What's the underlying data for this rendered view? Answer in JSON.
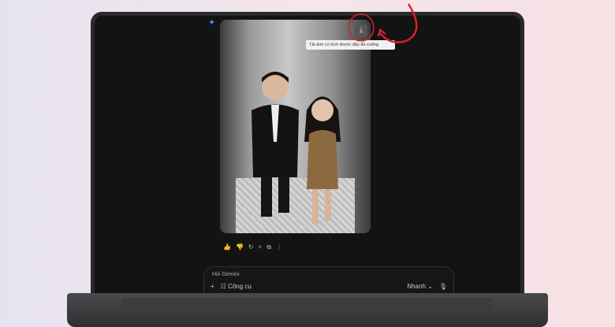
{
  "tooltip": {
    "text": "Tải ảnh có kích thước đầy đủ xuống"
  },
  "icons": {
    "download": "download-icon",
    "star": "gemini-star-icon"
  },
  "actions": [
    "thumbs-up",
    "thumbs-down",
    "regenerate",
    "share",
    "copy",
    "more"
  ],
  "action_glyphs": [
    "👍",
    "👎",
    "↻",
    "<",
    "⧉",
    "⋮"
  ],
  "input": {
    "placeholder": "Hỏi Gemini",
    "tools_label": "Công cụ",
    "mode_label": "Nhanh",
    "plus": "+",
    "chevron": "⌄"
  },
  "colors": {
    "annotation": "#d4222e",
    "accent": "#4b8cf5"
  }
}
